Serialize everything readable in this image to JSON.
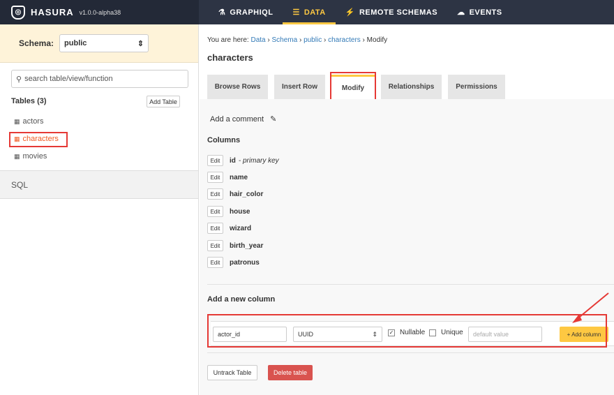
{
  "brand": {
    "name": "HASURA",
    "version": "v1.0.0-alpha38",
    "logo_glyph": "◎"
  },
  "nav": [
    {
      "label": "GRAPHIQL",
      "icon": "flask-icon",
      "glyph": "⚗"
    },
    {
      "label": "DATA",
      "icon": "database-icon",
      "glyph": "☰"
    },
    {
      "label": "REMOTE SCHEMAS",
      "icon": "plug-icon",
      "glyph": "⚡"
    },
    {
      "label": "EVENTS",
      "icon": "cloud-icon",
      "glyph": "☁"
    }
  ],
  "sidebar": {
    "schema_label": "Schema:",
    "schema_value": "public",
    "search_placeholder": "search table/view/function",
    "tables_heading": "Tables (3)",
    "add_table_label": "Add Table",
    "tables": [
      "actors",
      "characters",
      "movies"
    ],
    "active_table": "characters",
    "sql_label": "SQL"
  },
  "breadcrumb": {
    "prefix": "You are here:",
    "items": [
      "Data",
      "Schema",
      "public",
      "characters"
    ],
    "current": "Modify"
  },
  "page_title": "characters",
  "tabs": [
    "Browse Rows",
    "Insert Row",
    "Modify",
    "Relationships",
    "Permissions"
  ],
  "active_tab": "Modify",
  "comment_label": "Add a comment",
  "columns_heading": "Columns",
  "edit_label": "Edit",
  "columns": [
    {
      "name": "id",
      "note": "- primary key"
    },
    {
      "name": "name",
      "note": ""
    },
    {
      "name": "hair_color",
      "note": ""
    },
    {
      "name": "house",
      "note": ""
    },
    {
      "name": "wizard",
      "note": ""
    },
    {
      "name": "birth_year",
      "note": ""
    },
    {
      "name": "patronus",
      "note": ""
    }
  ],
  "new_column": {
    "heading": "Add a new column",
    "name_value": "actor_id",
    "type_value": "UUID",
    "nullable_label": "Nullable",
    "nullable_checked": true,
    "unique_label": "Unique",
    "unique_checked": false,
    "default_placeholder": "default value",
    "add_button": "+ Add column"
  },
  "untrack_label": "Untrack Table",
  "delete_label": "Delete table",
  "colors": {
    "accent": "#fec842",
    "topbar": "#2d3444",
    "danger": "#d9534f",
    "highlight": "#e53935"
  }
}
